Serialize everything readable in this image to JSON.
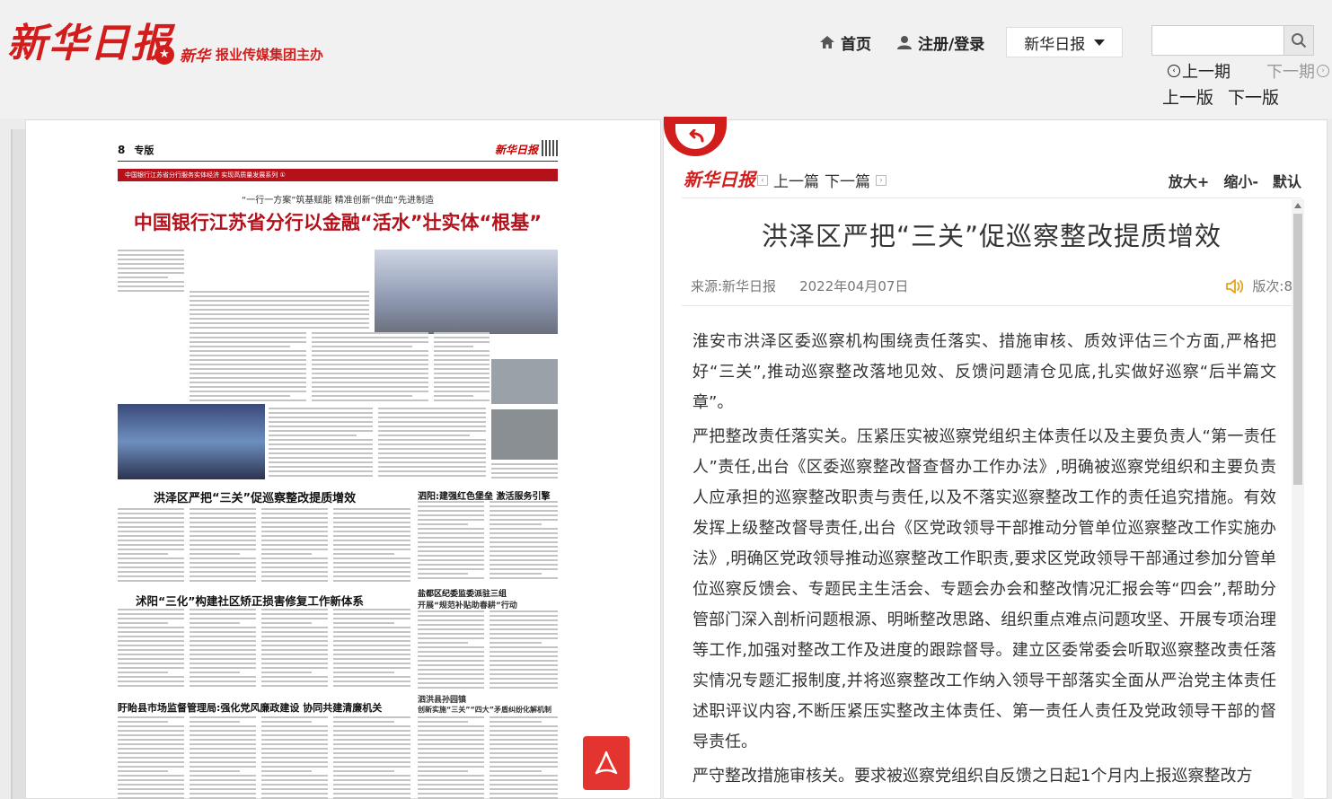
{
  "header": {
    "logo": "新华日报",
    "host_brand": "新华",
    "host_text": "报业传媒集团主办",
    "nav": {
      "home": "首页",
      "register": "注册/登录",
      "edition": "新华日报"
    },
    "search": {
      "placeholder": ""
    },
    "issue_nav": {
      "prev": "上一期",
      "next": "下一期"
    },
    "page_nav": {
      "prev": "上一版",
      "next": "下一版"
    }
  },
  "newspaper": {
    "page_no": "8",
    "section": "专版",
    "masthead": "新华日报",
    "banner_series": "中国银行江苏省分行服务实体经济 实现高质量发展系列 ①",
    "banner_sub": "“一行一方案”筑基赋能  精准创新“供血”先进制造",
    "banner_title": "中国银行江苏省分行以金融“活水”壮实体“根基”",
    "articles": [
      "洪泽区严把“三关”促巡察整改提质增效",
      "泗阳:建强红色堡垒 激活服务引擎",
      "沭阳“三化”构建社区矫正损害修复工作新体系",
      "盐都区纪委监委派驻三组",
      "开展“规范补贴助春耕”行动",
      "泗洪县孙园镇",
      "创新实施“三关”“四大”矛盾纠纷化解机制",
      "盱眙县市场监督管理局:强化党风廉政建设 协同共建清廉机关"
    ]
  },
  "article": {
    "logo": "新华日报",
    "prev": "上一篇",
    "next": "下一篇",
    "zoom_in": "放大+",
    "zoom_out": "缩小-",
    "zoom_default": "默认",
    "title": "洪泽区严把“三关”促巡察整改提质增效",
    "source": "来源:新华日报",
    "date": "2022年04月07日",
    "edition": "版次:8",
    "paragraphs": [
      "淮安市洪泽区委巡察机构围绕责任落实、措施审核、质效评估三个方面,严格把好“三关”,推动巡察整改落地见效、反馈问题清仓见底,扎实做好巡察“后半篇文章”。",
      "严把整改责任落实关。压紧压实被巡察党组织主体责任以及主要负责人“第一责任人”责任,出台《区委巡察整改督查督办工作办法》,明确被巡察党组织和主要负责人应承担的巡察整改职责与责任,以及不落实巡察整改工作的责任追究措施。有效发挥上级整改督导责任,出台《区党政领导干部推动分管单位巡察整改工作实施办法》,明确区党政领导推动巡察整改工作职责,要求区党政领导干部通过参加分管单位巡察反馈会、专题民主生活会、专题会办会和整改情况汇报会等“四会”,帮助分管部门深入剖析问题根源、明晰整改思路、组织重点难点问题攻坚、开展专项治理等工作,加强对整改工作及进度的跟踪督导。建立区委常委会听取巡察整改责任落实情况专题汇报制度,并将巡察整改工作纳入领导干部落实全面从严治党主体责任述职评议内容,不断压紧压实整改主体责任、第一责任人责任及党政领导干部的督导责任。",
      "严守整改措施审核关。要求被巡察党组织自反馈之日起1个月内上报巡察整改方"
    ]
  },
  "pdf": {
    "label": "PDF"
  },
  "colors": {
    "brand_red": "#d21d1d",
    "banner_red": "#b5111b"
  }
}
